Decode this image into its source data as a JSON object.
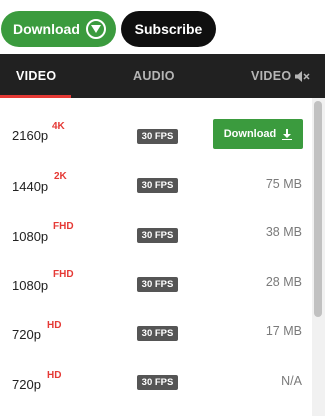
{
  "header": {
    "download_label": "Download",
    "download_icon": "chevron-down-circle-icon",
    "subscribe_label": "Subscribe"
  },
  "tabs": [
    {
      "label": "VIDEO",
      "active": true
    },
    {
      "label": "AUDIO",
      "active": false
    },
    {
      "label": "VIDEO",
      "active": false,
      "icon": "mute-icon"
    }
  ],
  "rows": [
    {
      "resolution": "2160p",
      "badge": "4K",
      "fps": "30 FPS",
      "size": "",
      "download_label": "Download",
      "download_icon": "download-icon"
    },
    {
      "resolution": "1440p",
      "badge": "2K",
      "fps": "30 FPS",
      "size": "75 MB"
    },
    {
      "resolution": "1080p",
      "badge": "FHD",
      "fps": "30 FPS",
      "size": "38 MB"
    },
    {
      "resolution": "1080p",
      "badge": "FHD",
      "fps": "30 FPS",
      "size": "28 MB"
    },
    {
      "resolution": "720p",
      "badge": "HD",
      "fps": "30 FPS",
      "size": "17 MB"
    },
    {
      "resolution": "720p",
      "badge": "HD",
      "fps": "30 FPS",
      "size": "N/A"
    }
  ],
  "colors": {
    "accent_green": "#3b9b3e",
    "badge_red": "#e53935",
    "tab_bar": "#212121"
  }
}
